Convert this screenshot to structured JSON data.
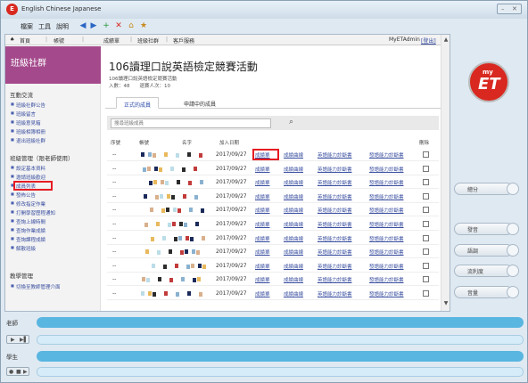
{
  "window": {
    "app_title": "English Chinese Japanese",
    "menu": [
      "檔案",
      "工具",
      "說明"
    ],
    "toolbar_icons": [
      "back-icon",
      "forward-icon",
      "plus-icon",
      "close-icon",
      "home-icon",
      "favorites-icon"
    ]
  },
  "topnav": {
    "items": [
      "首頁",
      "帳號",
      "成績單",
      "班級社群",
      "客戶服務"
    ],
    "user": "MyETAdmin",
    "logout": "[登出]"
  },
  "sidebar": {
    "banner_title": "班級社群",
    "sections": [
      {
        "title": "互動交流",
        "links": [
          "班級社群公告",
          "班級留言",
          "班級意見箱",
          "班級相簿相冊",
          "退出班級社群"
        ]
      },
      {
        "title": "班級管理（限老師使用）",
        "links": [
          "設定基本資料",
          "邀請班級歡迎",
          "成員列表",
          "發佈公告",
          "修改指定作業",
          "打開學習歷程通知",
          "查詢上線時間",
          "查詢作業成績",
          "查詢課程成績",
          "解散班級"
        ]
      },
      {
        "title": "教學管理",
        "links": [
          "切換至教師管理介面"
        ]
      }
    ]
  },
  "main": {
    "title": "106讀理口說英語檢定競賽活動",
    "subtitle": "106讀理口說英語檢定競賽活動",
    "counts": "入數：48　　退賽人次：10",
    "tabs": [
      "正式的成員",
      "申請中的成員"
    ],
    "search_placeholder": "搜尋班級成員",
    "columns": [
      "序號",
      "帳號",
      "名字",
      "加入日期",
      "刪除"
    ],
    "rows": [
      {
        "no": "--",
        "date": "2017/09/27",
        "links": [
          "成績單",
          "成績曲線",
          "英語能力診斷書",
          "發語能力診斷書"
        ]
      },
      {
        "no": "--",
        "date": "2017/09/27",
        "links": [
          "成績單",
          "成績曲線",
          "英語能力診斷書",
          "發語能力診斷書"
        ]
      },
      {
        "no": "--",
        "date": "2017/09/27",
        "links": [
          "成績單",
          "成績曲線",
          "英語能力診斷書",
          "發語能力診斷書"
        ]
      },
      {
        "no": "--",
        "date": "2017/09/27",
        "links": [
          "成績單",
          "成績曲線",
          "英語能力診斷書",
          "發語能力診斷書"
        ]
      },
      {
        "no": "--",
        "date": "2017/09/27",
        "links": [
          "成績單",
          "成績曲線",
          "英語能力診斷書",
          "發語能力診斷書"
        ]
      },
      {
        "no": "--",
        "date": "2017/09/27",
        "links": [
          "成績單",
          "成績曲線",
          "英語能力診斷書",
          "發語能力診斷書"
        ]
      },
      {
        "no": "--",
        "date": "2017/09/27",
        "links": [
          "成績單",
          "成績曲線",
          "英語能力診斷書",
          "發語能力診斷書"
        ]
      },
      {
        "no": "--",
        "date": "2017/09/27",
        "links": [
          "成績單",
          "成績曲線",
          "英語能力診斷書",
          "發語能力診斷書"
        ]
      },
      {
        "no": "--",
        "date": "2017/09/27",
        "links": [
          "成績單",
          "成績曲線",
          "英語能力診斷書",
          "發語能力診斷書"
        ]
      },
      {
        "no": "--",
        "date": "2017/09/27",
        "links": [
          "成績單",
          "成績曲線",
          "英語能力診斷書",
          "發語能力診斷書"
        ]
      },
      {
        "no": "--",
        "date": "2017/09/27",
        "links": [
          "成績單",
          "成績曲線",
          "英語能力診斷書",
          "發語能力診斷書"
        ]
      }
    ]
  },
  "brand": {
    "logo_top": "my",
    "logo_main": "ET"
  },
  "right_buttons": [
    "總分",
    "發音",
    "語調",
    "流利度",
    "音量"
  ],
  "panels": {
    "teacher": "老師",
    "student": "學生"
  },
  "colors": {
    "banner": "#a44a8c",
    "link": "#3a4fa0",
    "highlight": "#e51c23",
    "strip": "#59b6e0"
  }
}
